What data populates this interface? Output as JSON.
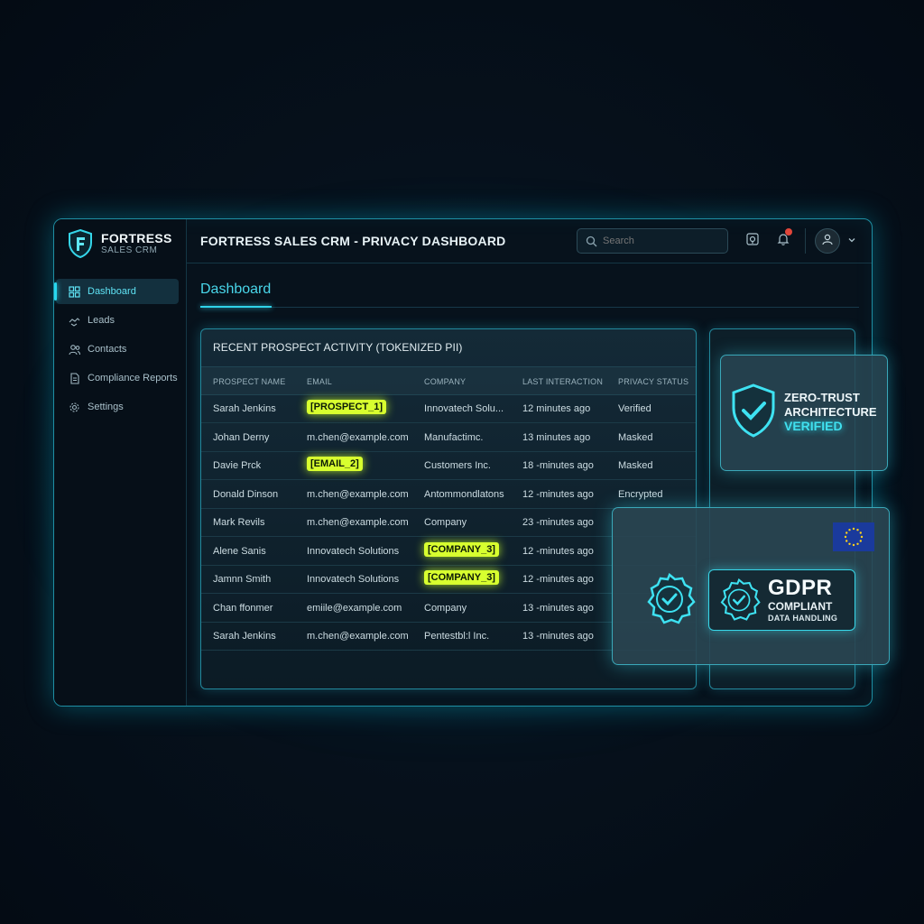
{
  "brand": {
    "name": "FORTRESS",
    "sub": "SALES CRM"
  },
  "header": {
    "title": "FORTRESS SALES CRM - PRIVACY DASHBOARD",
    "search_placeholder": "Search"
  },
  "sidebar": {
    "items": [
      {
        "label": "Dashboard",
        "icon": "grid-icon",
        "active": true
      },
      {
        "label": "Leads",
        "icon": "handshake-icon"
      },
      {
        "label": "Contacts",
        "icon": "users-icon"
      },
      {
        "label": "Compliance Reports",
        "icon": "document-icon"
      },
      {
        "label": "Settings",
        "icon": "gear-icon"
      }
    ]
  },
  "main": {
    "heading": "Dashboard"
  },
  "activity": {
    "title": "RECENT PROSPECT ACTIVITY (TOKENIZED PII)",
    "columns": [
      "PROSPECT NAME",
      "EMAIL",
      "COMPANY",
      "LAST INTERACTION",
      "PRIVACY STATUS"
    ],
    "rows": [
      {
        "name": "Sarah Jenkins",
        "email": "[PROSPECT_1]",
        "company": "Innovatech Solu...",
        "last": "12 minutes ago",
        "status": "Verified"
      },
      {
        "name": "Johan Derny",
        "email": "m.chen@example.com",
        "company": "Manufactimc.",
        "last": "13 minutes ago",
        "status": "Masked"
      },
      {
        "name": "Davie Prck",
        "email": "[EMAIL_2]",
        "company": "Customers Inc.",
        "last": "18 -minutes ago",
        "status": "Masked"
      },
      {
        "name": "Donald Dinson",
        "email": "m.chen@example.com",
        "company": "Antommondlatons",
        "last": "12 -minutes ago",
        "status": "Encrypted"
      },
      {
        "name": "Mark Revils",
        "email": "m.chen@example.com",
        "company": "Company",
        "last": "23 -minutes ago",
        "status": ""
      },
      {
        "name": "Alene Sanis",
        "email": "Innovatech Solutions",
        "company": "[COMPANY_3]",
        "last": "12 -minutes ago",
        "status": ""
      },
      {
        "name": "Jamnn Smith",
        "email": "Innovatech Solutions",
        "company": "[COMPANY_3]",
        "last": "12 -minutes ago",
        "status": ""
      },
      {
        "name": "Chan ffonmer",
        "email": "emiile@example.com",
        "company": "Company",
        "last": "13 -minutes ago",
        "status": ""
      },
      {
        "name": "Sarah Jenkins",
        "email": "m.chen@example.com",
        "company": "Pentestbl:l Inc.",
        "last": "13 -minutes ago",
        "status": ""
      }
    ]
  },
  "zero_trust": {
    "line1": "ZERO-TRUST",
    "line2": "ARCHITECTURE",
    "line3": "VERIFIED"
  },
  "gdpr": {
    "big": "GDPR",
    "mid": "COMPLIANT",
    "small": "DATA HANDLING"
  },
  "colors": {
    "accent": "#30d4ea",
    "token": "#d8ff2f",
    "alert": "#e2463a"
  }
}
